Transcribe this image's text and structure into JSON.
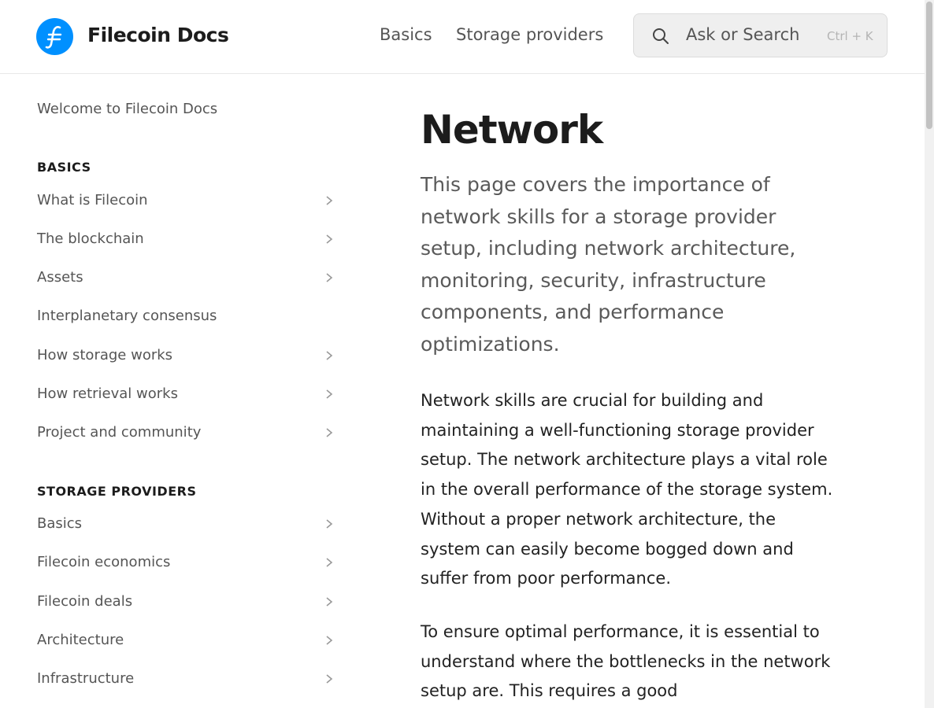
{
  "header": {
    "brand": "Filecoin Docs",
    "nav": [
      "Basics",
      "Storage providers"
    ],
    "search_placeholder": "Ask or Search",
    "search_shortcut": "Ctrl + K"
  },
  "sidebar": {
    "welcome": "Welcome to Filecoin Docs",
    "sections": [
      {
        "title": "BASICS",
        "items": [
          {
            "label": "What is Filecoin",
            "expandable": true
          },
          {
            "label": "The blockchain",
            "expandable": true
          },
          {
            "label": "Assets",
            "expandable": true
          },
          {
            "label": "Interplanetary consensus",
            "expandable": false
          },
          {
            "label": "How storage works",
            "expandable": true
          },
          {
            "label": "How retrieval works",
            "expandable": true
          },
          {
            "label": "Project and community",
            "expandable": true
          }
        ]
      },
      {
        "title": "STORAGE PROVIDERS",
        "items": [
          {
            "label": "Basics",
            "expandable": true
          },
          {
            "label": "Filecoin economics",
            "expandable": true
          },
          {
            "label": "Filecoin deals",
            "expandable": true
          },
          {
            "label": "Architecture",
            "expandable": true
          },
          {
            "label": "Infrastructure",
            "expandable": true
          }
        ]
      }
    ]
  },
  "main": {
    "title": "Network",
    "lead": "This page covers the importance of network skills for a storage provider setup, including network architecture, monitoring, security, infrastructure components, and performance optimizations.",
    "paragraphs": [
      "Network skills are crucial for building and maintaining a well-functioning storage provider setup. The network architecture plays a vital role in the overall performance of the storage system. Without a proper network architecture, the system can easily become bogged down and suffer from poor performance.",
      "To ensure optimal performance, it is essential to understand where the bottlenecks in the network setup are. This requires a good"
    ]
  },
  "colors": {
    "brand_blue": "#0090ff",
    "text_primary": "#1c1c1c",
    "text_muted": "#555555"
  },
  "icons": [
    "filecoin-logo-icon",
    "search-icon",
    "chevron-right-icon"
  ]
}
